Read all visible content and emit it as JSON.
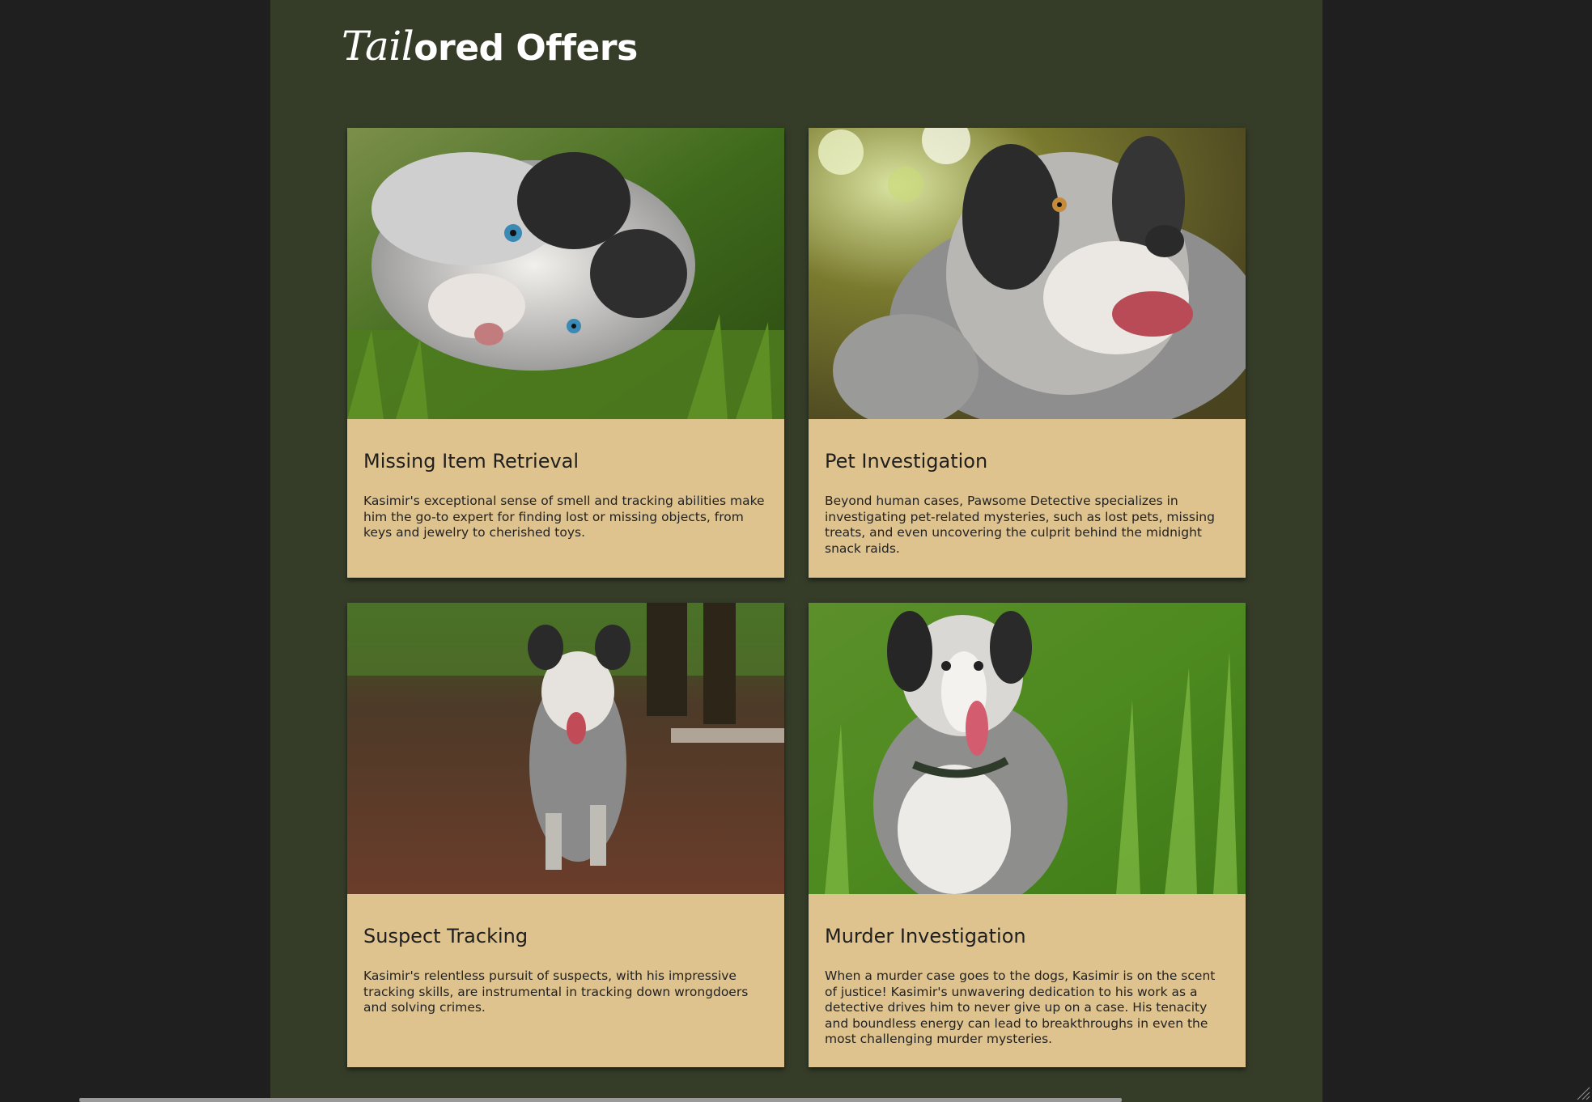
{
  "header": {
    "logo_part1": "Tail",
    "logo_part2": "ored Offers"
  },
  "cards": [
    {
      "title": "Missing Item Retrieval",
      "description": "Kasimir's exceptional sense of smell and tracking abilities make him the go-to expert for finding lost or missing objects, from keys and jewelry to cherished toys.",
      "image": "dog-lying-in-grass-photo"
    },
    {
      "title": "Pet Investigation",
      "description": "Beyond human cases, Pawsome Detective specializes in investigating pet-related mysteries, such as lost pets, missing treats, and even uncovering the culprit behind the midnight snack raids.",
      "image": "dog-smiling-forest-photo"
    },
    {
      "title": "Suspect Tracking",
      "description": "Kasimir's relentless pursuit of suspects, with his impressive tracking skills, are instrumental in tracking down wrongdoers and solving crimes.",
      "image": "dog-running-trail-photo"
    },
    {
      "title": "Murder Investigation",
      "description": "When a murder case goes to the dogs, Kasimir is on the scent of justice! Kasimir's unwavering dedication to his work as a detective drives him to never give up on a case. His tenacity and boundless energy can lead to breakthroughs in even the most challenging murder mysteries.",
      "image": "dog-sitting-grass-photo"
    }
  ],
  "colors": {
    "outer_background": "#1f1f1f",
    "page_background": "#353d29",
    "card_background": "#dfc38f",
    "logo_color": "#ffffff"
  }
}
